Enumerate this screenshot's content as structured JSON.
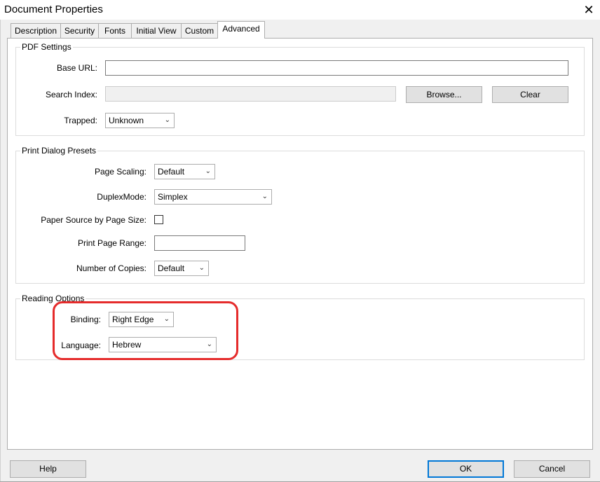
{
  "window": {
    "title": "Document Properties",
    "close_glyph": "✕"
  },
  "tabs": [
    {
      "label": "Description"
    },
    {
      "label": "Security"
    },
    {
      "label": "Fonts"
    },
    {
      "label": "Initial View"
    },
    {
      "label": "Custom"
    },
    {
      "label": "Advanced",
      "selected": true
    }
  ],
  "pdf_settings": {
    "title": "PDF Settings",
    "base_url": {
      "label": "Base URL:",
      "value": ""
    },
    "search_index": {
      "label": "Search Index:",
      "value": ""
    },
    "browse_label": "Browse...",
    "clear_label": "Clear",
    "trapped": {
      "label": "Trapped:",
      "value": "Unknown"
    }
  },
  "print_presets": {
    "title": "Print Dialog Presets",
    "page_scaling": {
      "label": "Page Scaling:",
      "value": "Default"
    },
    "duplex_mode": {
      "label": "DuplexMode:",
      "value": "Simplex"
    },
    "paper_source": {
      "label": "Paper Source by Page Size:",
      "checked": false
    },
    "print_page_range": {
      "label": "Print Page Range:",
      "value": ""
    },
    "number_of_copies": {
      "label": "Number of Copies:",
      "value": "Default"
    }
  },
  "reading_options": {
    "title": "Reading Options",
    "binding": {
      "label": "Binding:",
      "value": "Right Edge"
    },
    "language": {
      "label": "Language:",
      "value": "Hebrew"
    }
  },
  "footer": {
    "help_label": "Help",
    "ok_label": "OK",
    "cancel_label": "Cancel"
  },
  "colors": {
    "highlight": "#e52b2b",
    "focus": "#0078d7"
  },
  "icons": {
    "dropdown": "chevron-down-icon",
    "close": "close-icon"
  }
}
